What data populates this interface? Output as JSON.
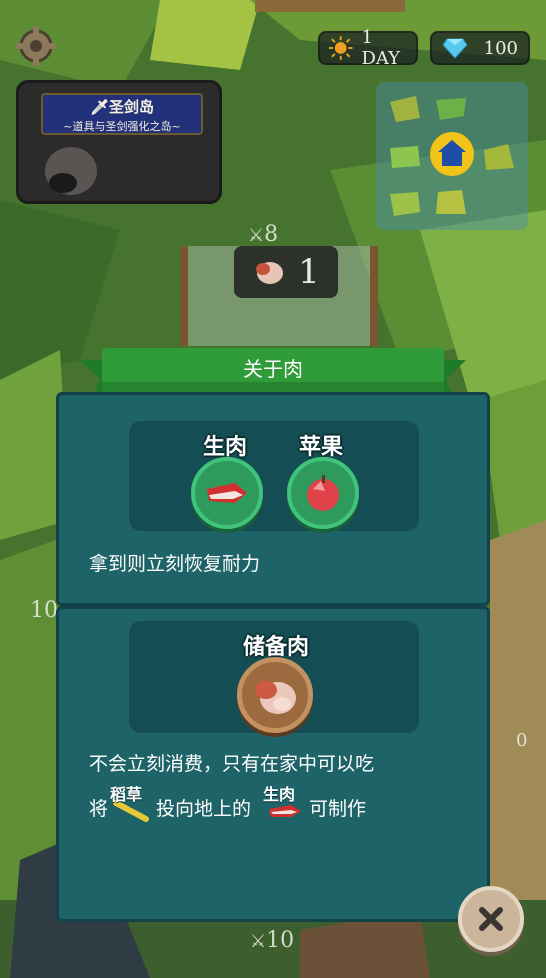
{
  "hud": {
    "day_label": "1 DAY",
    "gems": "100",
    "sun_icon": "sun-icon",
    "gem_icon": "diamond-icon"
  },
  "island": {
    "title": "圣剑岛",
    "subtitle": "~道具与圣剑强化之岛~"
  },
  "world": {
    "attack_top": "8",
    "meat_count": "1",
    "attack_left": "10",
    "attack_bottom": "10",
    "side_right_value": "0"
  },
  "dialog": {
    "title": "关于肉",
    "section1": {
      "items": [
        {
          "label": "生肉",
          "icon": "raw-meat-icon"
        },
        {
          "label": "苹果",
          "icon": "apple-icon"
        }
      ],
      "description": "拿到则立刻恢复耐力"
    },
    "section2": {
      "item": {
        "label": "储备肉",
        "icon": "stored-meat-icon"
      },
      "description_line1": "不会立刻消费，只有在家中可以吃",
      "line2_prefix": "将",
      "straw_label": "稻草",
      "line2_middle": "投向地上的",
      "meat_label": "生肉",
      "line2_suffix": "可制作"
    }
  },
  "colors": {
    "ribbon_green": "#2f9b39",
    "panel_teal": "#1e6367",
    "panel_inner": "#144e54"
  }
}
